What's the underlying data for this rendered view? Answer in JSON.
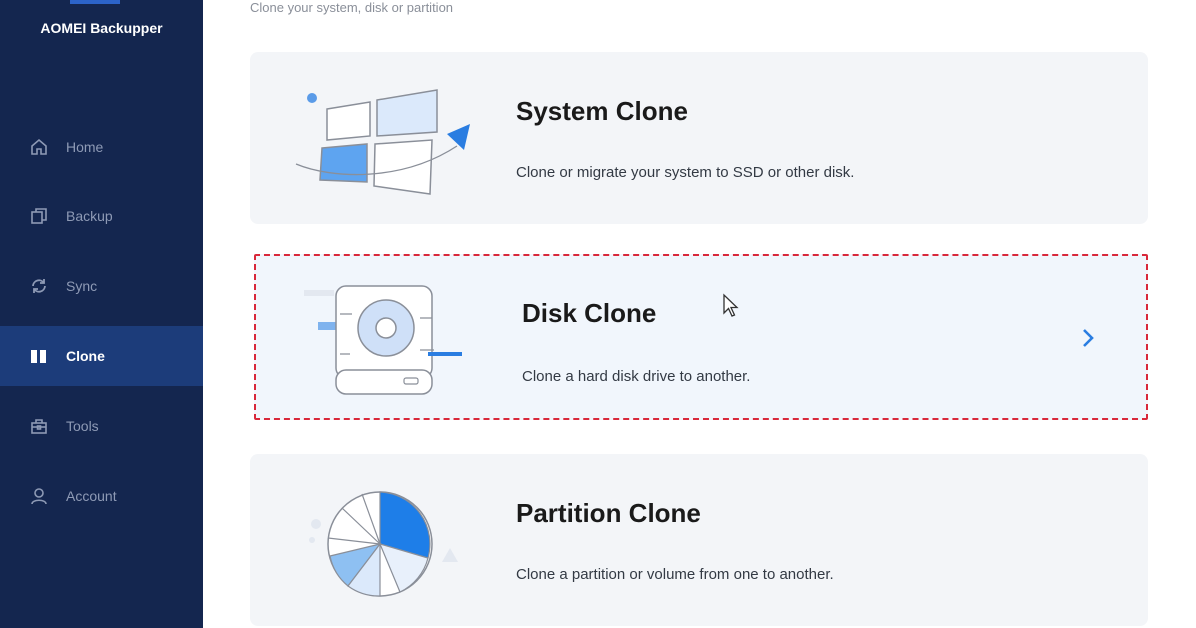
{
  "app": {
    "name": "AOMEI Backupper"
  },
  "sidebar": {
    "items": [
      {
        "label": "Home",
        "icon": "home-icon"
      },
      {
        "label": "Backup",
        "icon": "backup-icon"
      },
      {
        "label": "Sync",
        "icon": "sync-icon"
      },
      {
        "label": "Clone",
        "icon": "clone-icon",
        "active": true
      },
      {
        "label": "Tools",
        "icon": "tools-icon"
      },
      {
        "label": "Account",
        "icon": "account-icon"
      }
    ]
  },
  "main": {
    "subtitle": "Clone your system, disk or partition",
    "cards": [
      {
        "title": "System Clone",
        "desc": "Clone or migrate your system to SSD or other disk."
      },
      {
        "title": "Disk Clone",
        "desc": "Clone a hard disk drive to another.",
        "selected": true
      },
      {
        "title": "Partition Clone",
        "desc": "Clone a partition or volume from one to another."
      }
    ]
  },
  "colors": {
    "sidebar_bg": "#14264f",
    "sidebar_active": "#1c3c7a",
    "accent": "#2a7de1",
    "selection_border": "#d9283a"
  }
}
